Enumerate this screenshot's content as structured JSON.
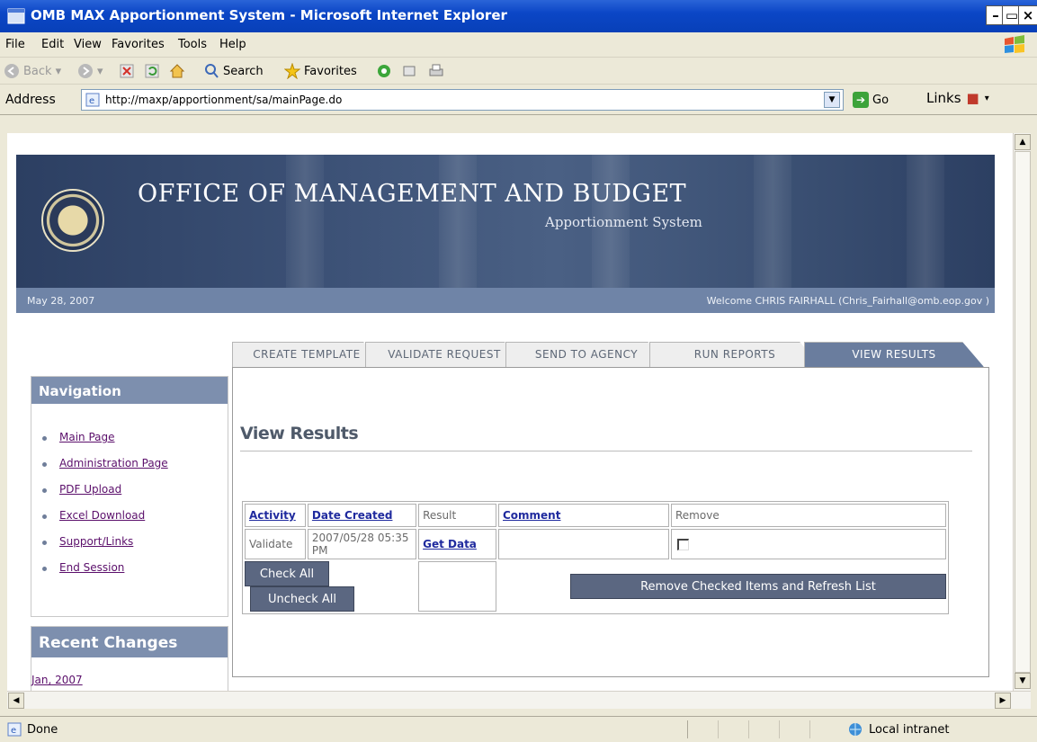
{
  "window": {
    "title": "OMB MAX Apportionment System - Microsoft Internet Explorer",
    "controls": [
      "_",
      "▢",
      "x"
    ]
  },
  "menu": [
    "File",
    "Edit",
    "View",
    "Favorites",
    "Tools",
    "Help"
  ],
  "toolbar": {
    "back": "Back",
    "search": "Search",
    "favorites": "Favorites"
  },
  "address": {
    "label": "Address",
    "url": "http://maxp/apportionment/sa/mainPage.do",
    "go": "Go",
    "links": "Links"
  },
  "banner": {
    "org": "OFFICE OF MANAGEMENT AND BUDGET",
    "system": "Apportionment System",
    "date": "May 28, 2007",
    "welcome": "Welcome CHRIS FAIRHALL (Chris_Fairhall@omb.eop.gov )"
  },
  "navigation": {
    "title": "Navigation",
    "items": [
      "Main Page",
      "Administration Page",
      "PDF Upload",
      "Excel Download",
      "Support/Links",
      "End Session"
    ]
  },
  "recent": {
    "title": "Recent Changes",
    "entry": "Jan, 2007"
  },
  "tabs": [
    "CREATE TEMPLATE",
    "VALIDATE REQUEST",
    "SEND TO AGENCY",
    "RUN REPORTS",
    "VIEW RESULTS"
  ],
  "active_tab": "VIEW RESULTS",
  "content": {
    "title": "View Results",
    "headers": [
      "Activity",
      "Date Created",
      "Result",
      "Comment",
      "Remove"
    ],
    "row": {
      "activity": "Validate",
      "date": "2007/05/28 05:35 PM",
      "result": "Get Data",
      "comment": "",
      "remove_checked": false
    },
    "buttons": {
      "check_all": "Check All",
      "uncheck_all": "Uncheck All",
      "remove_refresh": "Remove Checked Items and Refresh List"
    }
  },
  "status": {
    "left": "Done",
    "zone": "Local intranet"
  },
  "colors": {
    "title_bar": "#0b46c6",
    "banner": "#3b5075",
    "panel_header": "#7d8fae",
    "active_tab": "#6a7d9e",
    "button": "#5b6781",
    "link": "#1f2a9e"
  }
}
